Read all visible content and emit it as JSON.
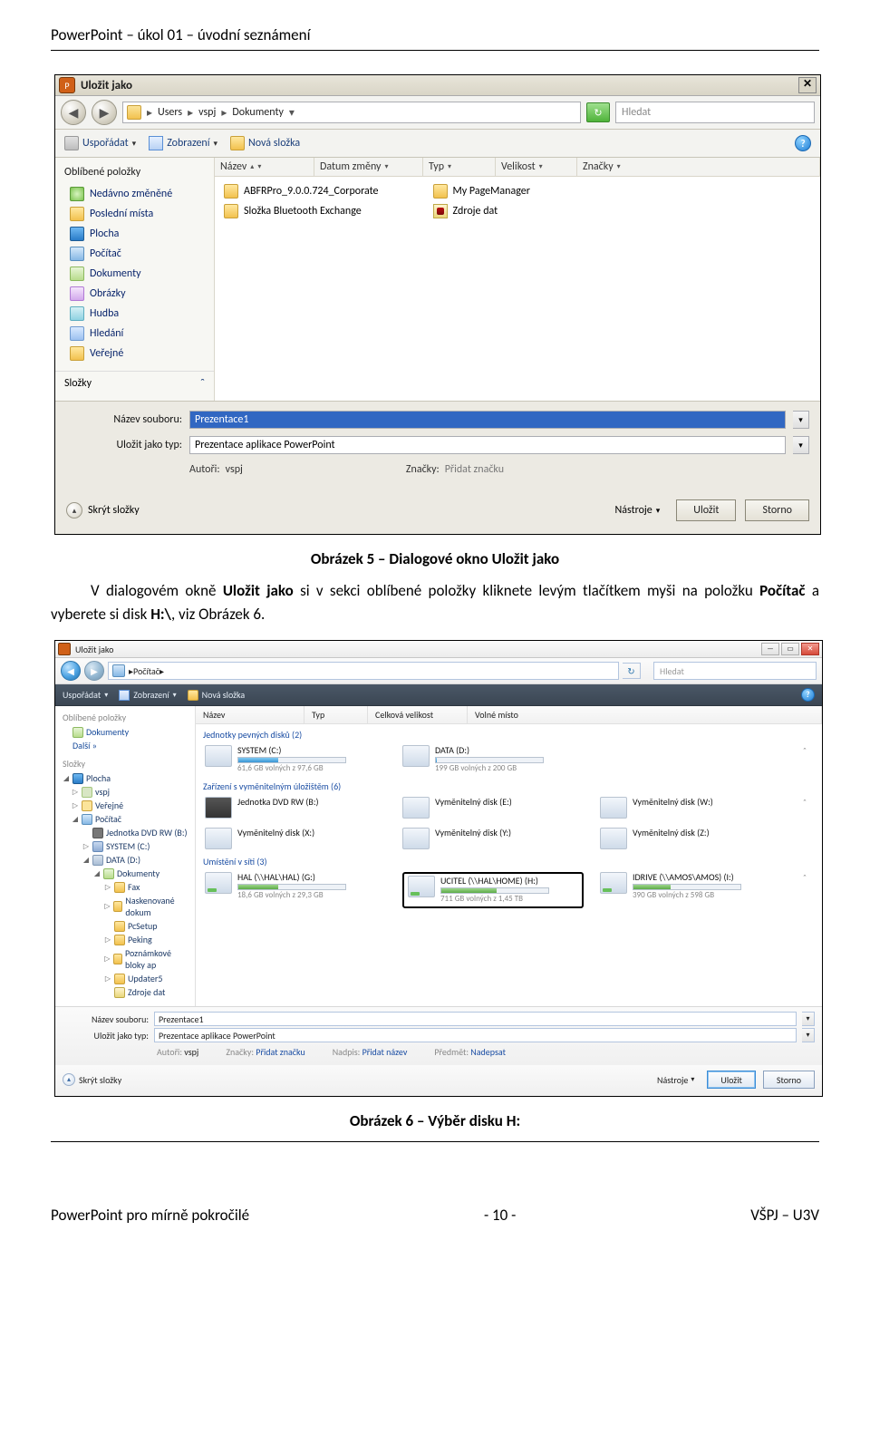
{
  "page_title": "PowerPoint – úkol 01 – úvodní seznámení",
  "caption5": "Obrázek 5 – Dialogové okno Uložit jako",
  "body_html_pre": "V dialogovém okně ",
  "body_html_b1": "Uložit jako",
  "body_html_mid": " si v sekci oblíbené položky kliknete levým tlačítkem myši na položku ",
  "body_html_b2": "Počítač",
  "body_html_mid2": " a vyberete si disk ",
  "body_html_b3": "H:\\",
  "body_html_post": ", viz Obrázek 6.",
  "caption6": "Obrázek 6 – Výběr disku H:",
  "footer_left": "PowerPoint pro mírně pokročilé",
  "footer_center": "- 10 -",
  "footer_right": "VŠPJ – U3V",
  "d1": {
    "title": "Uložit jako",
    "breadcrumb": [
      "Users",
      "vspj",
      "Dokumenty"
    ],
    "search_placeholder": "Hledat",
    "toolbar": {
      "organize": "Uspořádat",
      "views": "Zobrazení",
      "newfolder": "Nová složka"
    },
    "side_head": "Oblíbené položky",
    "side_items": [
      "Nedávno změněné",
      "Poslední místa",
      "Plocha",
      "Počítač",
      "Dokumenty",
      "Obrázky",
      "Hudba",
      "Hledání",
      "Veřejné"
    ],
    "side_folders": "Složky",
    "cols": [
      "Název",
      "Datum změny",
      "Typ",
      "Velikost",
      "Značky"
    ],
    "files_left": [
      "ABFRPro_9.0.0.724_Corporate",
      "Složka Bluetooth Exchange"
    ],
    "files_right": [
      "My PageManager",
      "Zdroje dat"
    ],
    "filename_label": "Název souboru:",
    "filename_value": "Prezentace1",
    "type_label": "Uložit jako typ:",
    "type_value": "Prezentace aplikace PowerPoint",
    "authors_label": "Autoři:",
    "authors_value": "vspj",
    "tags_label": "Značky:",
    "tags_value": "Přidat značku",
    "hide": "Skrýt složky",
    "tools": "Nástroje",
    "save": "Uložit",
    "cancel": "Storno"
  },
  "d2": {
    "title": "Uložit jako",
    "bc": "Počítač",
    "search_placeholder": "Hledat",
    "toolbar": {
      "organize": "Uspořádat",
      "views": "Zobrazení",
      "newfolder": "Nová složka"
    },
    "side_head1": "Oblíbené položky",
    "side1": [
      "Dokumenty",
      "Další »"
    ],
    "side_head2": "Složky",
    "tree": [
      "Plocha",
      "vspj",
      "Veřejné",
      "Počítač",
      "Jednotka DVD RW (B:)",
      "SYSTEM (C:)",
      "DATA (D:)",
      "Dokumenty",
      "Fax",
      "Naskenované dokum",
      "PcSetup",
      "Peking",
      "Poznámkové bloky ap",
      "Updater5",
      "Zdroje dat"
    ],
    "cols": [
      "Název",
      "Typ",
      "Celková velikost",
      "Volné místo"
    ],
    "groups": {
      "hdd": {
        "label": "Jednotky pevných disků (2)",
        "items": [
          {
            "name": "SYSTEM (C:)",
            "free": "61,6 GB volných z 97,6 GB",
            "bar": "b37"
          },
          {
            "name": "DATA (D:)",
            "free": "199 GB volných z 200 GB",
            "bar": "b1"
          }
        ]
      },
      "rem": {
        "label": "Zařízení s vyměnitelným úložištěm (6)",
        "items": [
          {
            "name": "Jednotka DVD RW (B:)",
            "kind": "dvd"
          },
          {
            "name": "Vyměnitelný disk (E:)"
          },
          {
            "name": "Vyměnitelný disk (W:)"
          },
          {
            "name": "Vyměnitelný disk (X:)"
          },
          {
            "name": "Vyměnitelný disk (Y:)"
          },
          {
            "name": "Vyměnitelný disk (Z:)"
          }
        ]
      },
      "net": {
        "label": "Umístění v síti (3)",
        "items": [
          {
            "name": "HAL (\\\\HAL\\HAL) (G:)",
            "free": "18,6 GB volných z 29,3 GB",
            "bar": "b37g"
          },
          {
            "name": "UCITEL (\\\\HAL\\HOME) (H:)",
            "free": "711 GB volných z 1,45 TB",
            "bar": "b52",
            "highlight": true
          },
          {
            "name": "IDRIVE (\\\\AMOS\\AMOS) (I:)",
            "free": "390 GB volných z 598 GB",
            "bar": "b35"
          }
        ]
      }
    },
    "filename_label": "Název souboru:",
    "filename_value": "Prezentace1",
    "type_label": "Uložit jako typ:",
    "type_value": "Prezentace aplikace PowerPoint",
    "authors_label": "Autoři:",
    "authors_value": "vspj",
    "tags_label": "Značky:",
    "tags_value": "Přidat značku",
    "title_label": "Nadpis:",
    "title_value": "Přidat název",
    "subject_label": "Předmět:",
    "subject_value": "Nadepsat",
    "hide": "Skrýt složky",
    "tools": "Nástroje",
    "save": "Uložit",
    "cancel": "Storno"
  }
}
